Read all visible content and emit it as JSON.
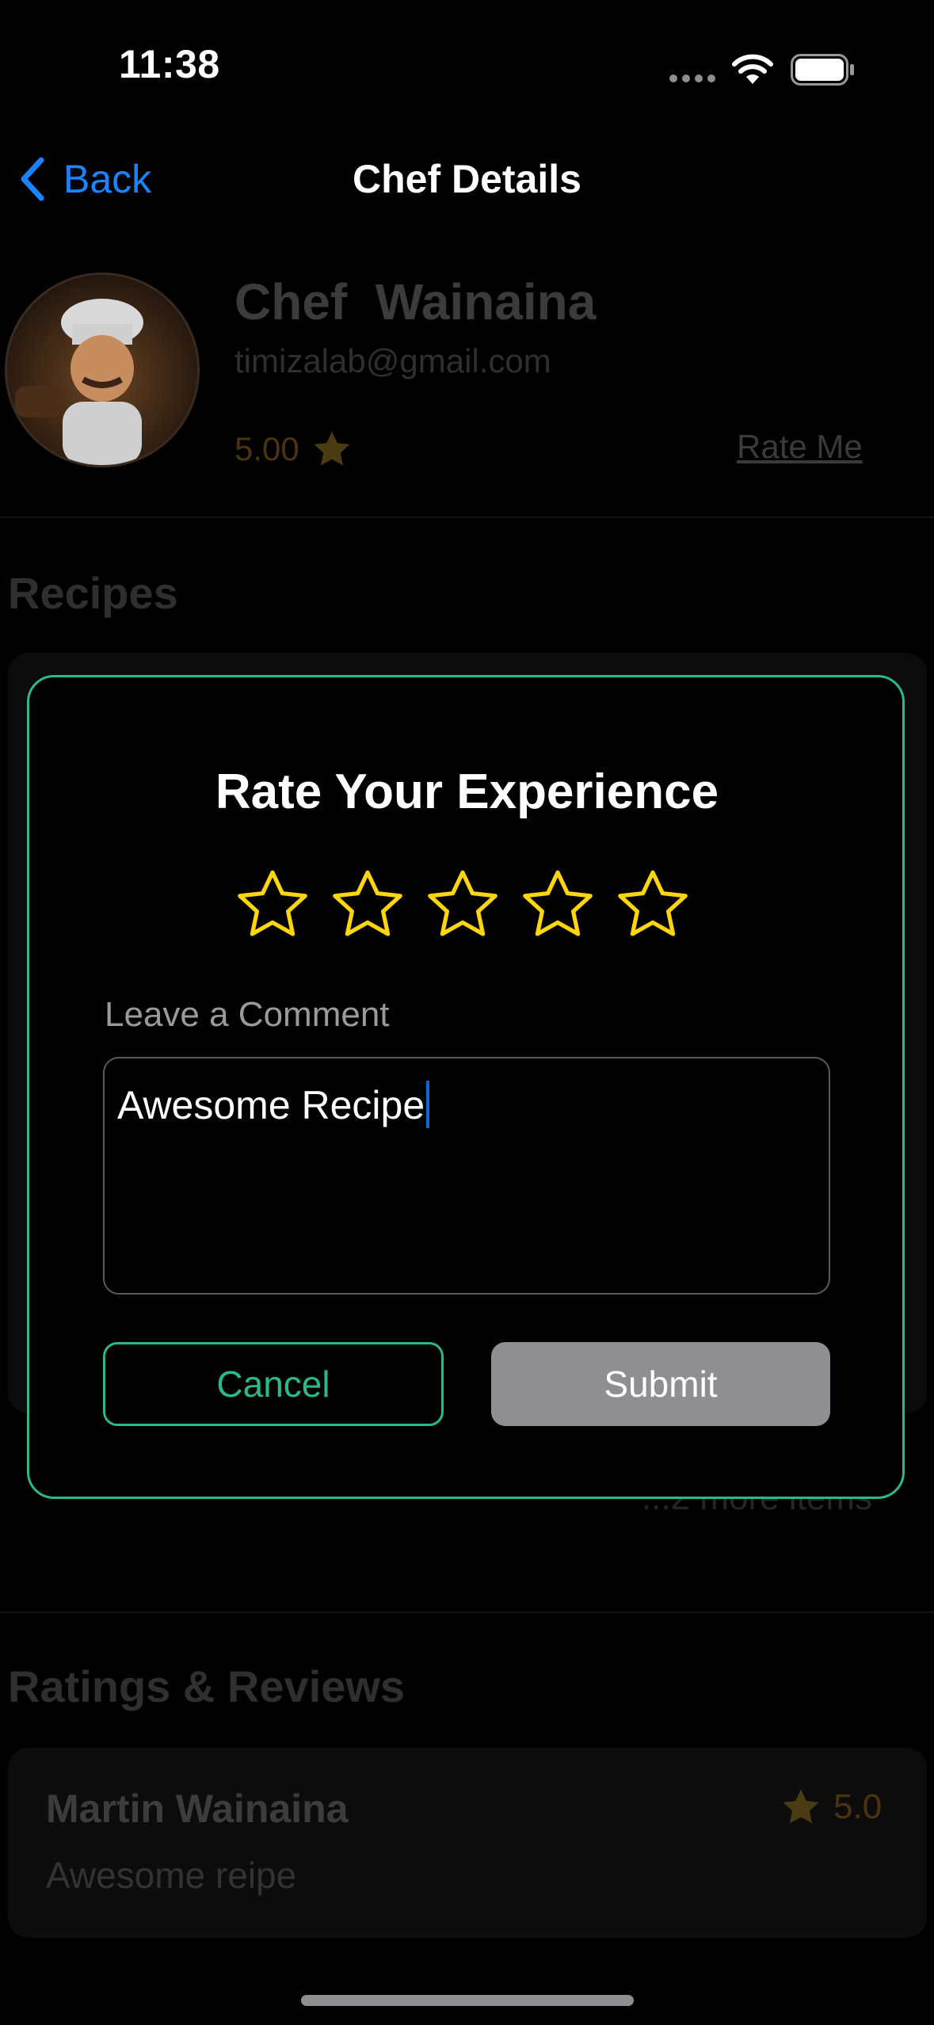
{
  "status_bar": {
    "time": "11:38"
  },
  "nav": {
    "back_label": "Back",
    "title": "Chef Details"
  },
  "chef": {
    "name": "Chef  Wainaina",
    "email": "timizalab@gmail.com",
    "rating": "5.00",
    "rate_me_label": "Rate Me"
  },
  "sections": {
    "recipes_title": "Recipes",
    "more_items": "...2 more items",
    "ratings_title": "Ratings & Reviews"
  },
  "review": {
    "reviewer": "Martin Wainaina",
    "text": "Awesome reipe",
    "score": "5.0"
  },
  "modal": {
    "title": "Rate Your Experience",
    "selected_stars": 0,
    "max_stars": 5,
    "comment_label": "Leave a Comment",
    "comment_value": "Awesome Recipe",
    "cancel_label": "Cancel",
    "submit_label": "Submit"
  },
  "colors": {
    "accent_green": "#2bb88a",
    "ios_blue": "#1a84ff",
    "star_yellow": "#ffd60a",
    "submit_gray": "#8e8e93"
  },
  "icons": [
    "chevron-left-icon",
    "wifi-icon",
    "battery-icon",
    "cellular-icon",
    "star-icon"
  ]
}
